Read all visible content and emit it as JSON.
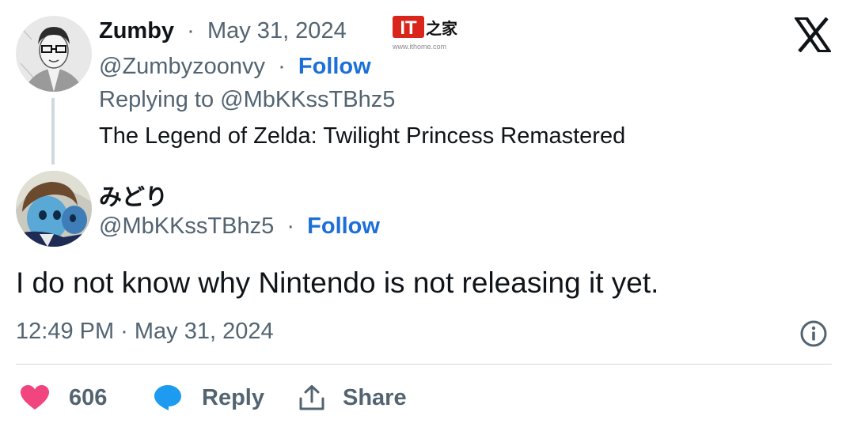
{
  "tweet_parent": {
    "display_name": "Zumby",
    "date": "May 31, 2024",
    "handle": "@Zumbyzoonvy",
    "follow_label": "Follow",
    "replying_to": "Replying to @MbKKssTBhz5",
    "text": "The Legend of Zelda: Twilight Princess Remastered"
  },
  "tweet_main": {
    "display_name": "みどり",
    "handle": "@MbKKssTBhz5",
    "follow_label": "Follow",
    "text": "I do not know why Nintendo is not releasing it yet.",
    "timestamp": "12:49 PM · May 31, 2024"
  },
  "actions": {
    "like_count": "606",
    "reply_label": "Reply",
    "share_label": "Share"
  },
  "watermark": {
    "brand": "IT之家",
    "url": "www.ithome.com"
  },
  "separator": "·",
  "colors": {
    "accent": "#1d6fd8",
    "muted": "#536471",
    "like": "#f0457e",
    "reply": "#1d9bf0",
    "text": "#0f1419"
  },
  "icons": [
    "x-logo-icon",
    "info-icon",
    "heart-icon",
    "speech-bubble-icon",
    "share-icon"
  ]
}
